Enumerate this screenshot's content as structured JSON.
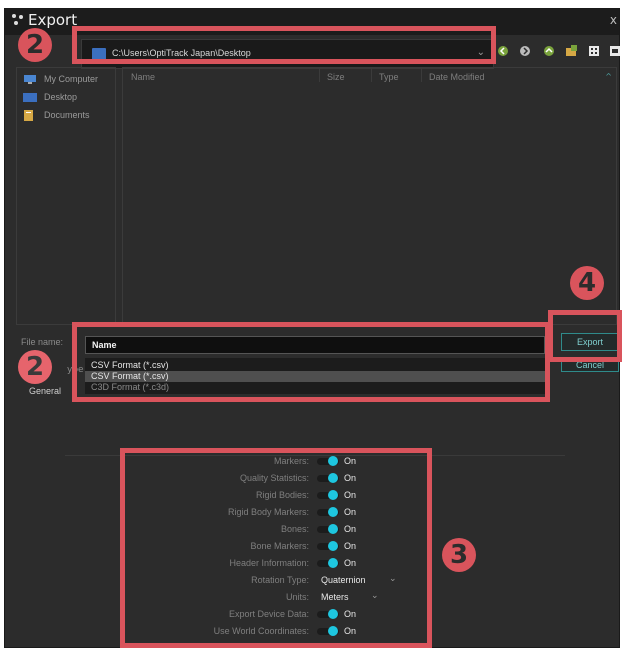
{
  "window": {
    "title": "Export",
    "close_glyph": "x"
  },
  "pathbar": {
    "path": "C:\\Users\\OptiTrack Japan\\Desktop",
    "folder_icon": "folder-icon"
  },
  "nav_icons": [
    "back-arrow-icon",
    "forward-arrow-icon",
    "up-arrow-icon",
    "new-folder-icon",
    "view-grid-icon",
    "view-list-icon"
  ],
  "places": [
    {
      "label": "My Computer",
      "icon": "computer-icon"
    },
    {
      "label": "Desktop",
      "icon": "desktop-icon"
    },
    {
      "label": "Documents",
      "icon": "documents-icon"
    }
  ],
  "file_columns": [
    "Name",
    "Size",
    "Type",
    "Date Modified"
  ],
  "file_name": {
    "label": "File name:",
    "value": "Name"
  },
  "file_type": {
    "label_fragment": "ype",
    "options": [
      "CSV Format (*.csv)",
      "CSV Format (*.csv)",
      "C3D Format (*.c3d)"
    ],
    "selected_index": 1
  },
  "general_label": "General",
  "buttons": {
    "export": "Export",
    "cancel": "Cancel"
  },
  "options": [
    {
      "label": "Markers:",
      "value": "On"
    },
    {
      "label": "Quality Statistics:",
      "value": "On"
    },
    {
      "label": "Rigid Bodies:",
      "value": "On"
    },
    {
      "label": "Rigid Body Markers:",
      "value": "On"
    },
    {
      "label": "Bones:",
      "value": "On"
    },
    {
      "label": "Bone Markers:",
      "value": "On"
    },
    {
      "label": "Header Information:",
      "value": "On"
    },
    {
      "label": "Rotation Type:",
      "value": "Quaternion"
    },
    {
      "label": "Units:",
      "value": "Meters"
    },
    {
      "label": "Export Device Data:",
      "value": "On"
    },
    {
      "label": "Use World Coordinates:",
      "value": "On"
    }
  ],
  "annotations": {
    "badge_path": "2",
    "badge_type": "2",
    "badge_options": "3",
    "badge_export": "4"
  },
  "colors": {
    "accent": "#1ec7e0",
    "annotation": "#d9545c",
    "background": "#2c2c2c"
  }
}
